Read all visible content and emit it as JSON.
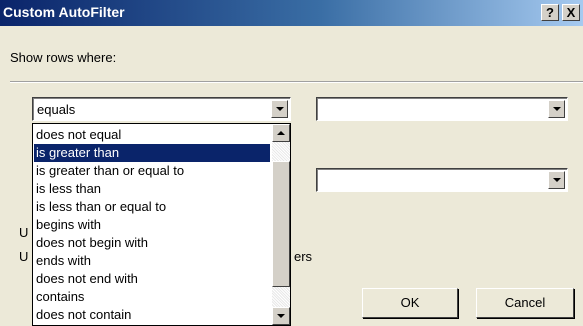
{
  "window": {
    "title": "Custom AutoFilter",
    "help_label": "?",
    "close_label": "X"
  },
  "dialog": {
    "show_rows_label": "Show rows where:",
    "operator1": {
      "value": "equals"
    },
    "value1": {
      "value": ""
    },
    "value2": {
      "value": ""
    },
    "operator_list": {
      "items": [
        "does not equal",
        "is greater than",
        "is greater than or equal to",
        "is less than",
        "is less than or equal to",
        "begins with",
        "does not begin with",
        "ends with",
        "does not end with",
        "contains",
        "does not contain"
      ],
      "selected_index": 1
    },
    "partial_labels": {
      "u1": "U",
      "u2": "U",
      "ers": "ers"
    },
    "ok_label": "OK",
    "cancel_label": "Cancel"
  },
  "icons": [
    "dropdown-arrow-icon",
    "scroll-up-icon",
    "scroll-down-icon"
  ]
}
